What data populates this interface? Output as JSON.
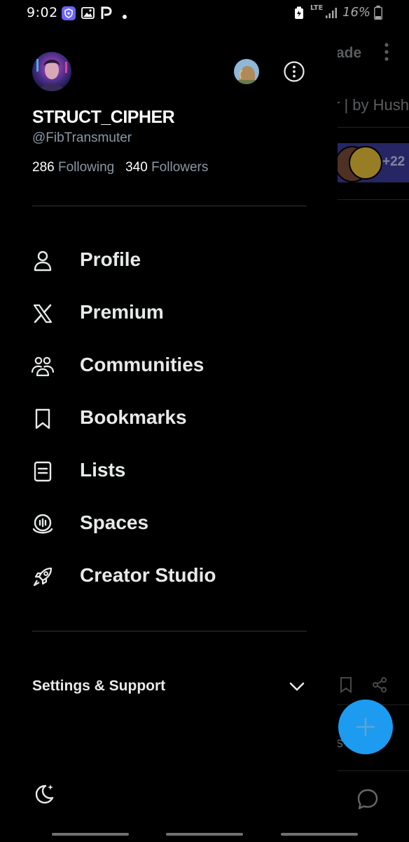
{
  "status_bar": {
    "time": "9:02",
    "network": "LTE",
    "battery": "16%"
  },
  "background": {
    "header_fragment": "ade",
    "title_fragment": "r | by Hush",
    "avatar_count": "+22",
    "bottom_fragment": "s      er"
  },
  "drawer": {
    "display_name": "STRUCT_CIPHER",
    "handle": "@FibTransmuter",
    "following_count": "286",
    "following_label": "Following",
    "followers_count": "340",
    "followers_label": "Followers",
    "menu": [
      {
        "label": "Profile",
        "icon": "person-icon"
      },
      {
        "label": "Premium",
        "icon": "x-logo-icon"
      },
      {
        "label": "Communities",
        "icon": "communities-icon"
      },
      {
        "label": "Bookmarks",
        "icon": "bookmark-icon"
      },
      {
        "label": "Lists",
        "icon": "list-icon"
      },
      {
        "label": "Spaces",
        "icon": "spaces-icon"
      },
      {
        "label": "Creator Studio",
        "icon": "rocket-icon"
      }
    ],
    "settings_label": "Settings & Support"
  },
  "colors": {
    "background": "#000000",
    "text": "#e7e9ea",
    "secondary_text": "#8b98a5",
    "divider": "#2f3336",
    "accent": "#1d9bf0"
  }
}
